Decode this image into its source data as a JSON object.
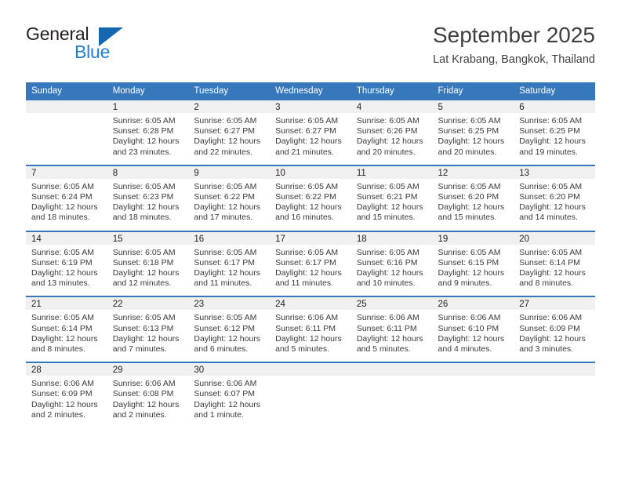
{
  "brand": {
    "name_part1": "General",
    "name_part2": "Blue",
    "accent_color": "#1567b0",
    "blue_text_color": "#1f7fd4"
  },
  "header": {
    "title": "September 2025",
    "location": "Lat Krabang, Bangkok, Thailand"
  },
  "calendar": {
    "header_bg": "#3777bc",
    "daynum_bg": "#f0f0f0",
    "weekdays": [
      "Sunday",
      "Monday",
      "Tuesday",
      "Wednesday",
      "Thursday",
      "Friday",
      "Saturday"
    ],
    "weeks": [
      [
        {
          "day": "",
          "sunrise": "",
          "sunset": "",
          "daylight1": "",
          "daylight2": ""
        },
        {
          "day": "1",
          "sunrise": "Sunrise: 6:05 AM",
          "sunset": "Sunset: 6:28 PM",
          "daylight1": "Daylight: 12 hours",
          "daylight2": "and 23 minutes."
        },
        {
          "day": "2",
          "sunrise": "Sunrise: 6:05 AM",
          "sunset": "Sunset: 6:27 PM",
          "daylight1": "Daylight: 12 hours",
          "daylight2": "and 22 minutes."
        },
        {
          "day": "3",
          "sunrise": "Sunrise: 6:05 AM",
          "sunset": "Sunset: 6:27 PM",
          "daylight1": "Daylight: 12 hours",
          "daylight2": "and 21 minutes."
        },
        {
          "day": "4",
          "sunrise": "Sunrise: 6:05 AM",
          "sunset": "Sunset: 6:26 PM",
          "daylight1": "Daylight: 12 hours",
          "daylight2": "and 20 minutes."
        },
        {
          "day": "5",
          "sunrise": "Sunrise: 6:05 AM",
          "sunset": "Sunset: 6:25 PM",
          "daylight1": "Daylight: 12 hours",
          "daylight2": "and 20 minutes."
        },
        {
          "day": "6",
          "sunrise": "Sunrise: 6:05 AM",
          "sunset": "Sunset: 6:25 PM",
          "daylight1": "Daylight: 12 hours",
          "daylight2": "and 19 minutes."
        }
      ],
      [
        {
          "day": "7",
          "sunrise": "Sunrise: 6:05 AM",
          "sunset": "Sunset: 6:24 PM",
          "daylight1": "Daylight: 12 hours",
          "daylight2": "and 18 minutes."
        },
        {
          "day": "8",
          "sunrise": "Sunrise: 6:05 AM",
          "sunset": "Sunset: 6:23 PM",
          "daylight1": "Daylight: 12 hours",
          "daylight2": "and 18 minutes."
        },
        {
          "day": "9",
          "sunrise": "Sunrise: 6:05 AM",
          "sunset": "Sunset: 6:22 PM",
          "daylight1": "Daylight: 12 hours",
          "daylight2": "and 17 minutes."
        },
        {
          "day": "10",
          "sunrise": "Sunrise: 6:05 AM",
          "sunset": "Sunset: 6:22 PM",
          "daylight1": "Daylight: 12 hours",
          "daylight2": "and 16 minutes."
        },
        {
          "day": "11",
          "sunrise": "Sunrise: 6:05 AM",
          "sunset": "Sunset: 6:21 PM",
          "daylight1": "Daylight: 12 hours",
          "daylight2": "and 15 minutes."
        },
        {
          "day": "12",
          "sunrise": "Sunrise: 6:05 AM",
          "sunset": "Sunset: 6:20 PM",
          "daylight1": "Daylight: 12 hours",
          "daylight2": "and 15 minutes."
        },
        {
          "day": "13",
          "sunrise": "Sunrise: 6:05 AM",
          "sunset": "Sunset: 6:20 PM",
          "daylight1": "Daylight: 12 hours",
          "daylight2": "and 14 minutes."
        }
      ],
      [
        {
          "day": "14",
          "sunrise": "Sunrise: 6:05 AM",
          "sunset": "Sunset: 6:19 PM",
          "daylight1": "Daylight: 12 hours",
          "daylight2": "and 13 minutes."
        },
        {
          "day": "15",
          "sunrise": "Sunrise: 6:05 AM",
          "sunset": "Sunset: 6:18 PM",
          "daylight1": "Daylight: 12 hours",
          "daylight2": "and 12 minutes."
        },
        {
          "day": "16",
          "sunrise": "Sunrise: 6:05 AM",
          "sunset": "Sunset: 6:17 PM",
          "daylight1": "Daylight: 12 hours",
          "daylight2": "and 11 minutes."
        },
        {
          "day": "17",
          "sunrise": "Sunrise: 6:05 AM",
          "sunset": "Sunset: 6:17 PM",
          "daylight1": "Daylight: 12 hours",
          "daylight2": "and 11 minutes."
        },
        {
          "day": "18",
          "sunrise": "Sunrise: 6:05 AM",
          "sunset": "Sunset: 6:16 PM",
          "daylight1": "Daylight: 12 hours",
          "daylight2": "and 10 minutes."
        },
        {
          "day": "19",
          "sunrise": "Sunrise: 6:05 AM",
          "sunset": "Sunset: 6:15 PM",
          "daylight1": "Daylight: 12 hours",
          "daylight2": "and 9 minutes."
        },
        {
          "day": "20",
          "sunrise": "Sunrise: 6:05 AM",
          "sunset": "Sunset: 6:14 PM",
          "daylight1": "Daylight: 12 hours",
          "daylight2": "and 8 minutes."
        }
      ],
      [
        {
          "day": "21",
          "sunrise": "Sunrise: 6:05 AM",
          "sunset": "Sunset: 6:14 PM",
          "daylight1": "Daylight: 12 hours",
          "daylight2": "and 8 minutes."
        },
        {
          "day": "22",
          "sunrise": "Sunrise: 6:05 AM",
          "sunset": "Sunset: 6:13 PM",
          "daylight1": "Daylight: 12 hours",
          "daylight2": "and 7 minutes."
        },
        {
          "day": "23",
          "sunrise": "Sunrise: 6:05 AM",
          "sunset": "Sunset: 6:12 PM",
          "daylight1": "Daylight: 12 hours",
          "daylight2": "and 6 minutes."
        },
        {
          "day": "24",
          "sunrise": "Sunrise: 6:06 AM",
          "sunset": "Sunset: 6:11 PM",
          "daylight1": "Daylight: 12 hours",
          "daylight2": "and 5 minutes."
        },
        {
          "day": "25",
          "sunrise": "Sunrise: 6:06 AM",
          "sunset": "Sunset: 6:11 PM",
          "daylight1": "Daylight: 12 hours",
          "daylight2": "and 5 minutes."
        },
        {
          "day": "26",
          "sunrise": "Sunrise: 6:06 AM",
          "sunset": "Sunset: 6:10 PM",
          "daylight1": "Daylight: 12 hours",
          "daylight2": "and 4 minutes."
        },
        {
          "day": "27",
          "sunrise": "Sunrise: 6:06 AM",
          "sunset": "Sunset: 6:09 PM",
          "daylight1": "Daylight: 12 hours",
          "daylight2": "and 3 minutes."
        }
      ],
      [
        {
          "day": "28",
          "sunrise": "Sunrise: 6:06 AM",
          "sunset": "Sunset: 6:09 PM",
          "daylight1": "Daylight: 12 hours",
          "daylight2": "and 2 minutes."
        },
        {
          "day": "29",
          "sunrise": "Sunrise: 6:06 AM",
          "sunset": "Sunset: 6:08 PM",
          "daylight1": "Daylight: 12 hours",
          "daylight2": "and 2 minutes."
        },
        {
          "day": "30",
          "sunrise": "Sunrise: 6:06 AM",
          "sunset": "Sunset: 6:07 PM",
          "daylight1": "Daylight: 12 hours",
          "daylight2": "and 1 minute."
        },
        {
          "day": "",
          "sunrise": "",
          "sunset": "",
          "daylight1": "",
          "daylight2": ""
        },
        {
          "day": "",
          "sunrise": "",
          "sunset": "",
          "daylight1": "",
          "daylight2": ""
        },
        {
          "day": "",
          "sunrise": "",
          "sunset": "",
          "daylight1": "",
          "daylight2": ""
        },
        {
          "day": "",
          "sunrise": "",
          "sunset": "",
          "daylight1": "",
          "daylight2": ""
        }
      ]
    ]
  }
}
